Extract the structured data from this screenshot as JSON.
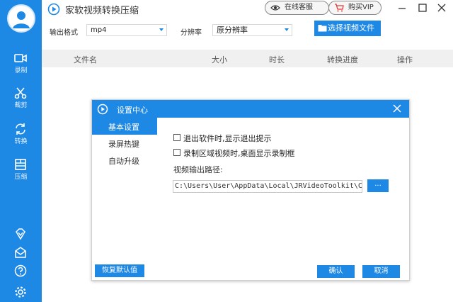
{
  "app": {
    "title": "家软视频转换压缩",
    "online_service": "在线客服",
    "buy_vip": "购买VIP"
  },
  "sidebar": {
    "items": [
      {
        "label": "录制",
        "icon": "video-camera-icon"
      },
      {
        "label": "裁剪",
        "icon": "scissors-icon"
      },
      {
        "label": "转换",
        "icon": "convert-icon"
      },
      {
        "label": "压缩",
        "icon": "compress-icon"
      }
    ],
    "bottom_icons": [
      "vip-diamond-icon",
      "mail-icon",
      "help-icon",
      "settings-icon"
    ]
  },
  "toolbar": {
    "output_format_label": "输出格式",
    "output_format_value": "mp4",
    "resolution_label": "分辨率",
    "resolution_value": "原分辨率",
    "choose_file_button": "选择视频文件"
  },
  "table": {
    "columns": [
      "文件名",
      "大小",
      "时长",
      "转换进度",
      "操作"
    ]
  },
  "dialog": {
    "title": "设置中心",
    "menu": [
      "基本设置",
      "录屏热键",
      "自动升级"
    ],
    "active_menu": "基本设置",
    "options": [
      {
        "label": "退出软件时,显示退出提示",
        "checked": false
      },
      {
        "label": "录制区域视频时,桌面显示录制框",
        "checked": false
      }
    ],
    "path_label": "视频输出路径:",
    "path_value": "C:\\Users\\User\\AppData\\Local\\JRVideoToolkit\\C",
    "browse_button": "...",
    "restore_defaults_button": "恢复默认值",
    "ok_button": "确认",
    "cancel_button": "取消"
  },
  "colors": {
    "accent": "#1e88e5",
    "header_bg": "#f0f0f0",
    "sidebar_bg": "#1e88e5"
  }
}
